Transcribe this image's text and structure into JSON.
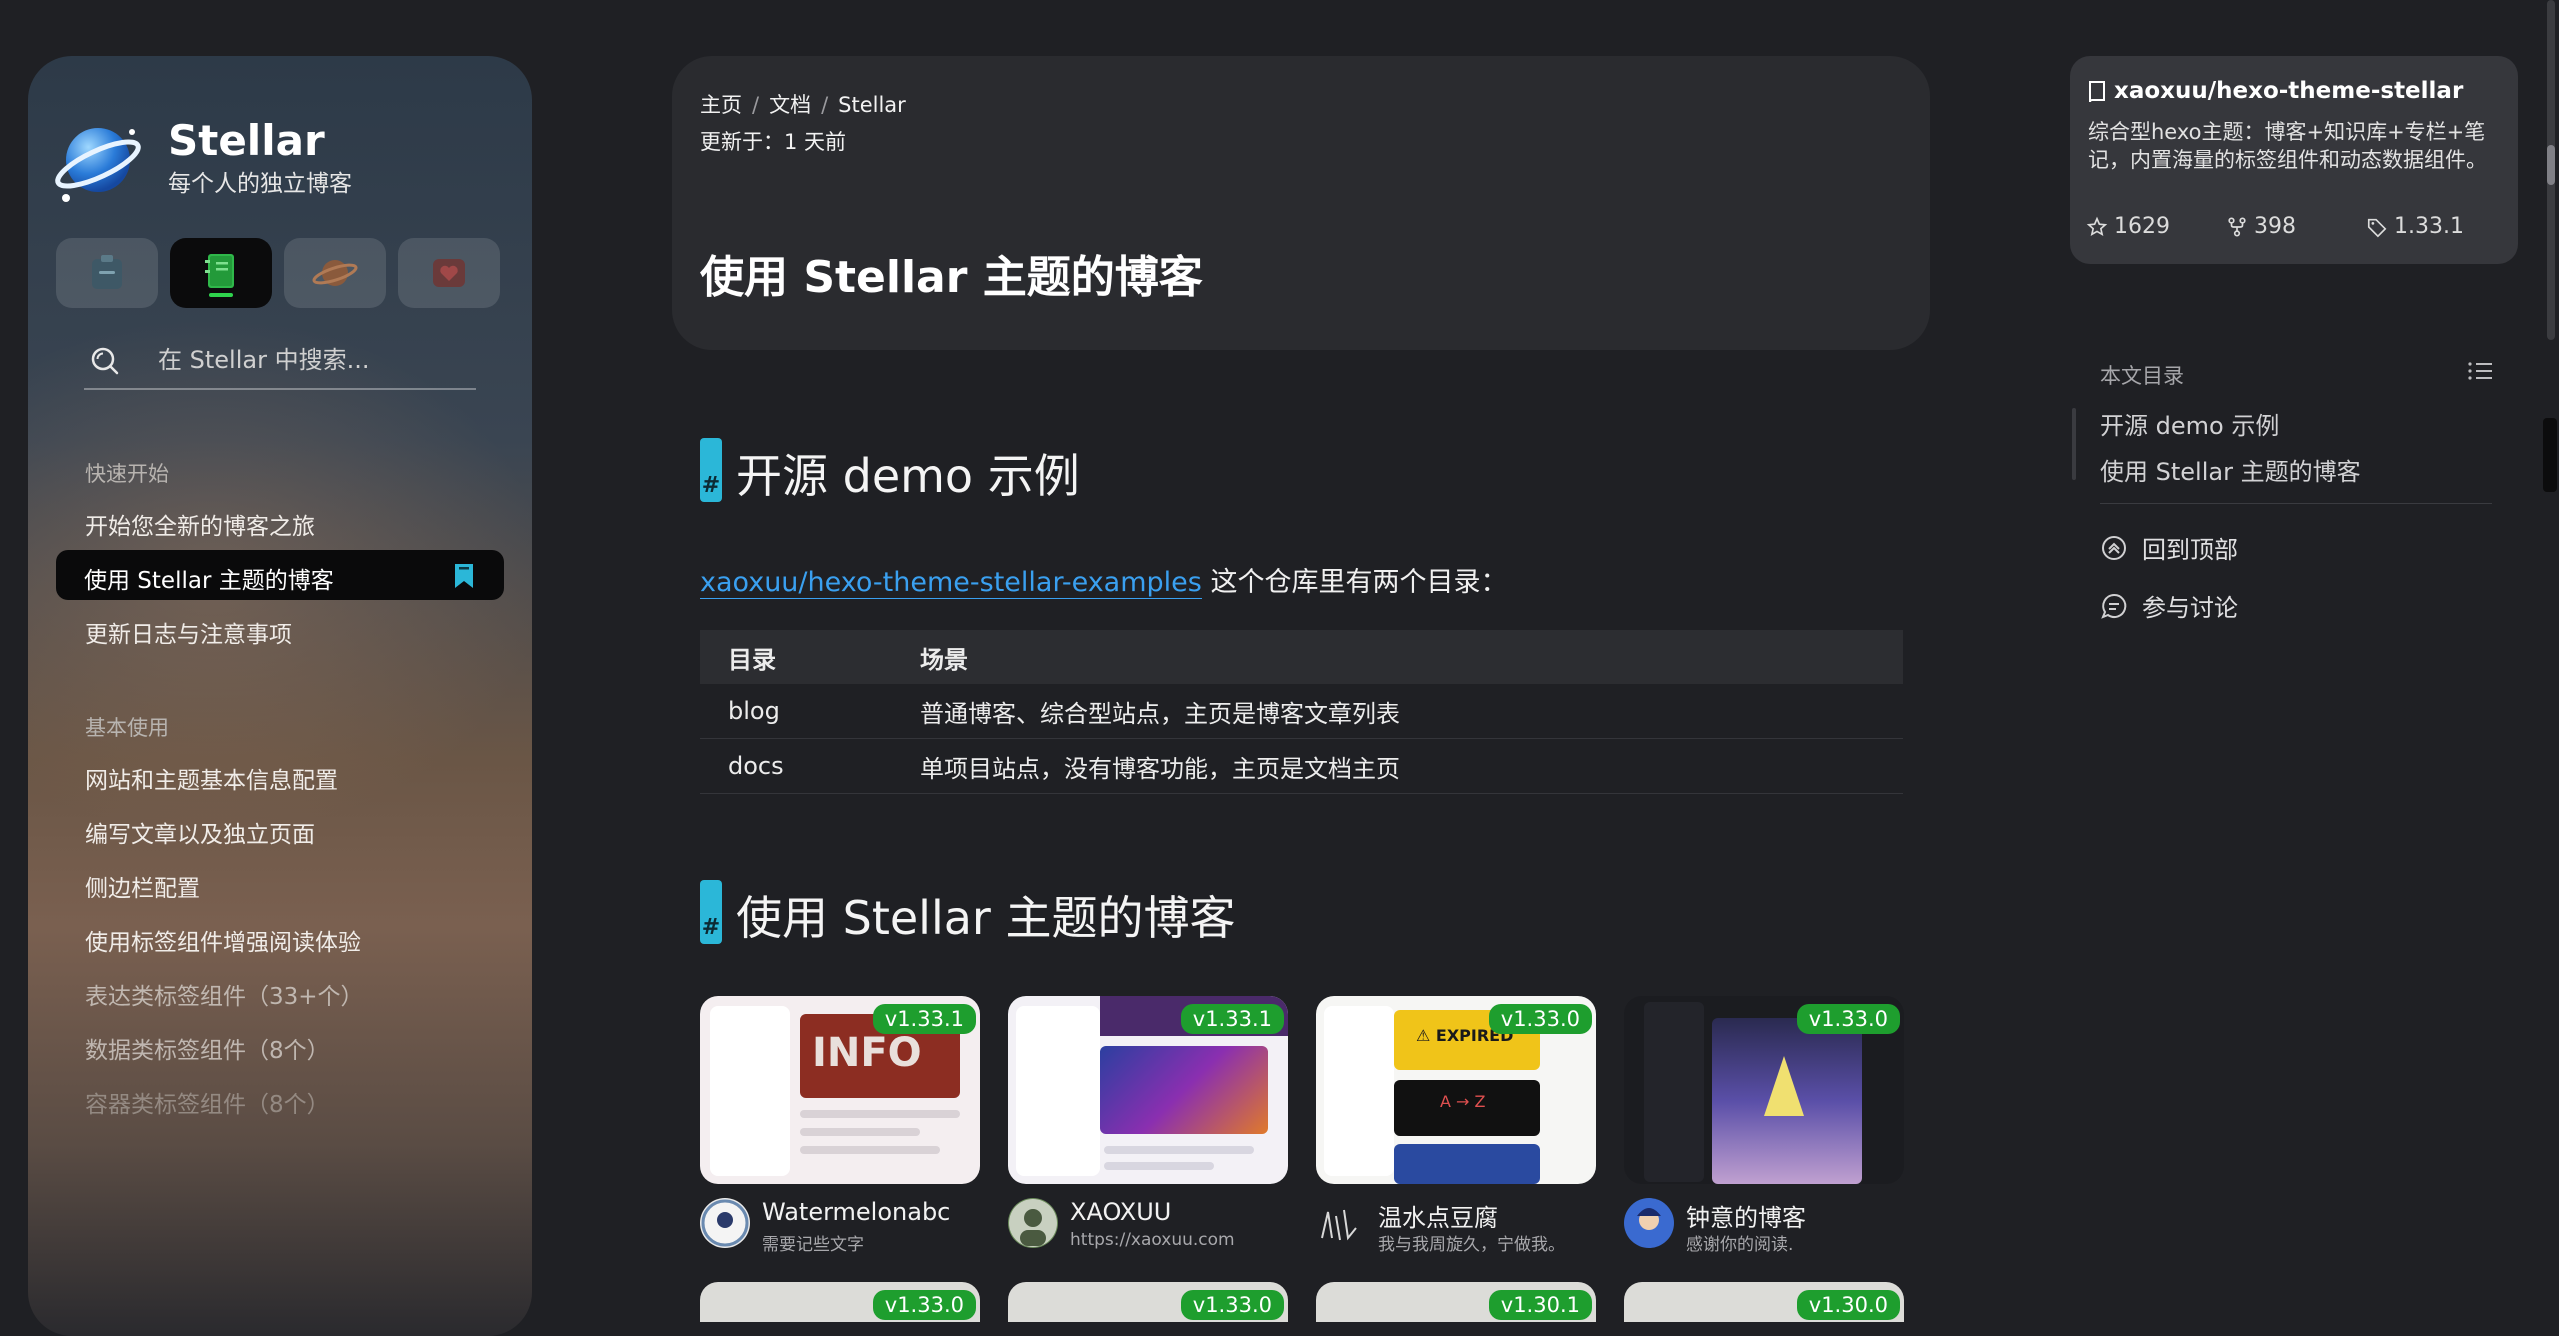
{
  "site": {
    "title": "Stellar",
    "subtitle": "每个人的独立博客",
    "nav_buttons": [
      {
        "icon": "note-icon"
      },
      {
        "icon": "notebook-icon",
        "active": true
      },
      {
        "icon": "planet-icon"
      },
      {
        "icon": "heart-icon"
      }
    ],
    "search_placeholder": "在 Stellar 中搜索..."
  },
  "sidebar": {
    "groups": [
      {
        "title": "快速开始",
        "items": [
          "开始您全新的博客之旅",
          "使用 Stellar 主题的博客",
          "更新日志与注意事项"
        ],
        "active_index": 1
      },
      {
        "title": "基本使用",
        "items": [
          "网站和主题基本信息配置",
          "编写文章以及独立页面",
          "侧边栏配置",
          "使用标签组件增强阅读体验",
          "表达类标签组件（33+个）",
          "数据类标签组件（8个）",
          "容器类标签组件（8个）"
        ]
      }
    ]
  },
  "header": {
    "breadcrumb": [
      "主页",
      "文档",
      "Stellar"
    ],
    "updated": "更新于：1 天前",
    "title": "使用 Stellar 主题的博客"
  },
  "content": {
    "section1": {
      "heading": "开源 demo 示例",
      "hash": "#",
      "intro_link": "xaoxuu/hexo-theme-stellar-examples",
      "intro_text": " 这个仓库里有两个目录：",
      "table": {
        "headers": [
          "目录",
          "场景"
        ],
        "rows": [
          [
            "blog",
            "普通博客、综合型站点，主页是博客文章列表"
          ],
          [
            "docs",
            "单项目站点，没有博客功能，主页是文档主页"
          ]
        ]
      }
    },
    "section2": {
      "heading": "使用 Stellar 主题的博客",
      "hash": "#",
      "sites": [
        {
          "name": "Watermelonabc",
          "desc": "需要记些文字",
          "version": "v1.33.1",
          "thumb_colors": [
            "#f4eef0",
            "#c0392b"
          ]
        },
        {
          "name": "XAOXUU",
          "desc": "https://xaoxuu.com",
          "version": "v1.33.1",
          "thumb_colors": [
            "#f3f1f6",
            "#6a3fb0"
          ]
        },
        {
          "name": "温水点豆腐",
          "desc": "我与我周旋久，宁做我。",
          "version": "v1.33.0",
          "thumb_colors": [
            "#f6f6f4",
            "#f0c419"
          ]
        },
        {
          "name": "钟意的博客",
          "desc": "感谢你的阅读.",
          "version": "v1.33.0",
          "thumb_colors": [
            "#1b1c20",
            "#5a4fa8"
          ]
        }
      ],
      "more_versions": [
        "v1.33.0",
        "v1.33.0",
        "v1.30.1",
        "v1.30.0"
      ]
    }
  },
  "right": {
    "repo": {
      "name": "xaoxuu/hexo-theme-stellar",
      "description": "综合型hexo主题：博客+知识库+专栏+笔记，内置海量的标签组件和动态数据组件。",
      "stars": "1629",
      "forks": "398",
      "version": "1.33.1"
    },
    "toc": {
      "title": "本文目录",
      "items": [
        "开源 demo 示例",
        "使用 Stellar 主题的博客"
      ]
    },
    "actions": {
      "back_to_top": "回到顶部",
      "discuss": "参与讨论"
    }
  },
  "colors": {
    "accent": "#2bb7d8",
    "link": "#3aa0f0",
    "badge": "#1e9e2e",
    "background": "#1f2024"
  }
}
